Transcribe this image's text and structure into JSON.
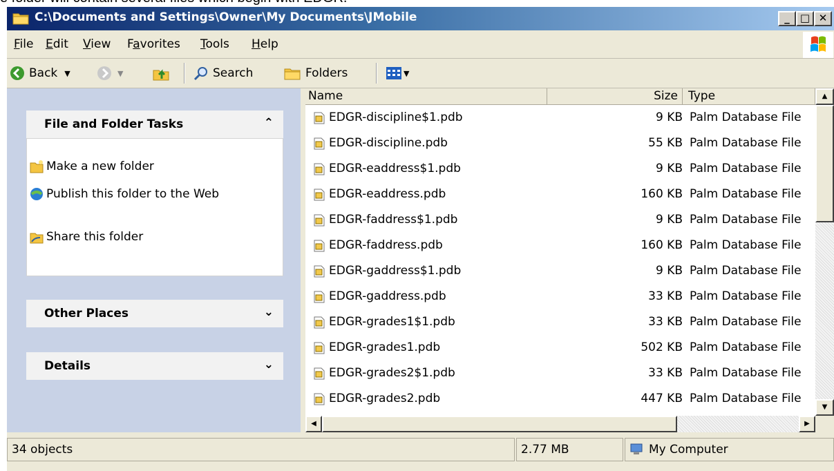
{
  "window": {
    "title": "C:\\Documents and Settings\\Owner\\My Documents\\JMobile",
    "caption_buttons": {
      "minimize": "_",
      "maximize": "□",
      "close": "✕"
    }
  },
  "above_caption": "e folder will contain several files which begin with EDGR.",
  "menu": [
    {
      "pre": "",
      "ul": "F",
      "post": "ile"
    },
    {
      "pre": "",
      "ul": "E",
      "post": "dit"
    },
    {
      "pre": "",
      "ul": "V",
      "post": "iew"
    },
    {
      "pre": "F",
      "ul": "a",
      "post": "vorites"
    },
    {
      "pre": "",
      "ul": "T",
      "post": "ools"
    },
    {
      "pre": "",
      "ul": "H",
      "post": "elp"
    }
  ],
  "toolbar": {
    "back": "Back",
    "search": "Search",
    "folders": "Folders"
  },
  "taskpane": {
    "file_tasks": {
      "title": "File and Folder Tasks",
      "chevron": "⌃",
      "items": [
        "Make a new folder",
        "Publish this folder to the Web",
        "Share this folder"
      ]
    },
    "other_places": {
      "title": "Other Places",
      "chevron": "⌄"
    },
    "details": {
      "title": "Details",
      "chevron": "⌄"
    }
  },
  "filelist": {
    "columns": [
      "Name",
      "Size",
      "Type"
    ],
    "rows": [
      {
        "name": "EDGR-discipline$1.pdb",
        "size": "9 KB",
        "type": "Palm Database File"
      },
      {
        "name": "EDGR-discipline.pdb",
        "size": "55 KB",
        "type": "Palm Database File"
      },
      {
        "name": "EDGR-eaddress$1.pdb",
        "size": "9 KB",
        "type": "Palm Database File"
      },
      {
        "name": "EDGR-eaddress.pdb",
        "size": "160 KB",
        "type": "Palm Database File"
      },
      {
        "name": "EDGR-faddress$1.pdb",
        "size": "9 KB",
        "type": "Palm Database File"
      },
      {
        "name": "EDGR-faddress.pdb",
        "size": "160 KB",
        "type": "Palm Database File"
      },
      {
        "name": "EDGR-gaddress$1.pdb",
        "size": "9 KB",
        "type": "Palm Database File"
      },
      {
        "name": "EDGR-gaddress.pdb",
        "size": "33 KB",
        "type": "Palm Database File"
      },
      {
        "name": "EDGR-grades1$1.pdb",
        "size": "33 KB",
        "type": "Palm Database File"
      },
      {
        "name": "EDGR-grades1.pdb",
        "size": "502 KB",
        "type": "Palm Database File"
      },
      {
        "name": "EDGR-grades2$1.pdb",
        "size": "33 KB",
        "type": "Palm Database File"
      },
      {
        "name": "EDGR-grades2.pdb",
        "size": "447 KB",
        "type": "Palm Database File"
      }
    ]
  },
  "statusbar": {
    "objects": "34 objects",
    "size": "2.77 MB",
    "zone": "My Computer"
  },
  "colors": {
    "titlebar_start": "#0a246a",
    "titlebar_end": "#a6caf0",
    "taskpane_bg": "#c8d2e6",
    "chrome": "#ece9d8"
  }
}
